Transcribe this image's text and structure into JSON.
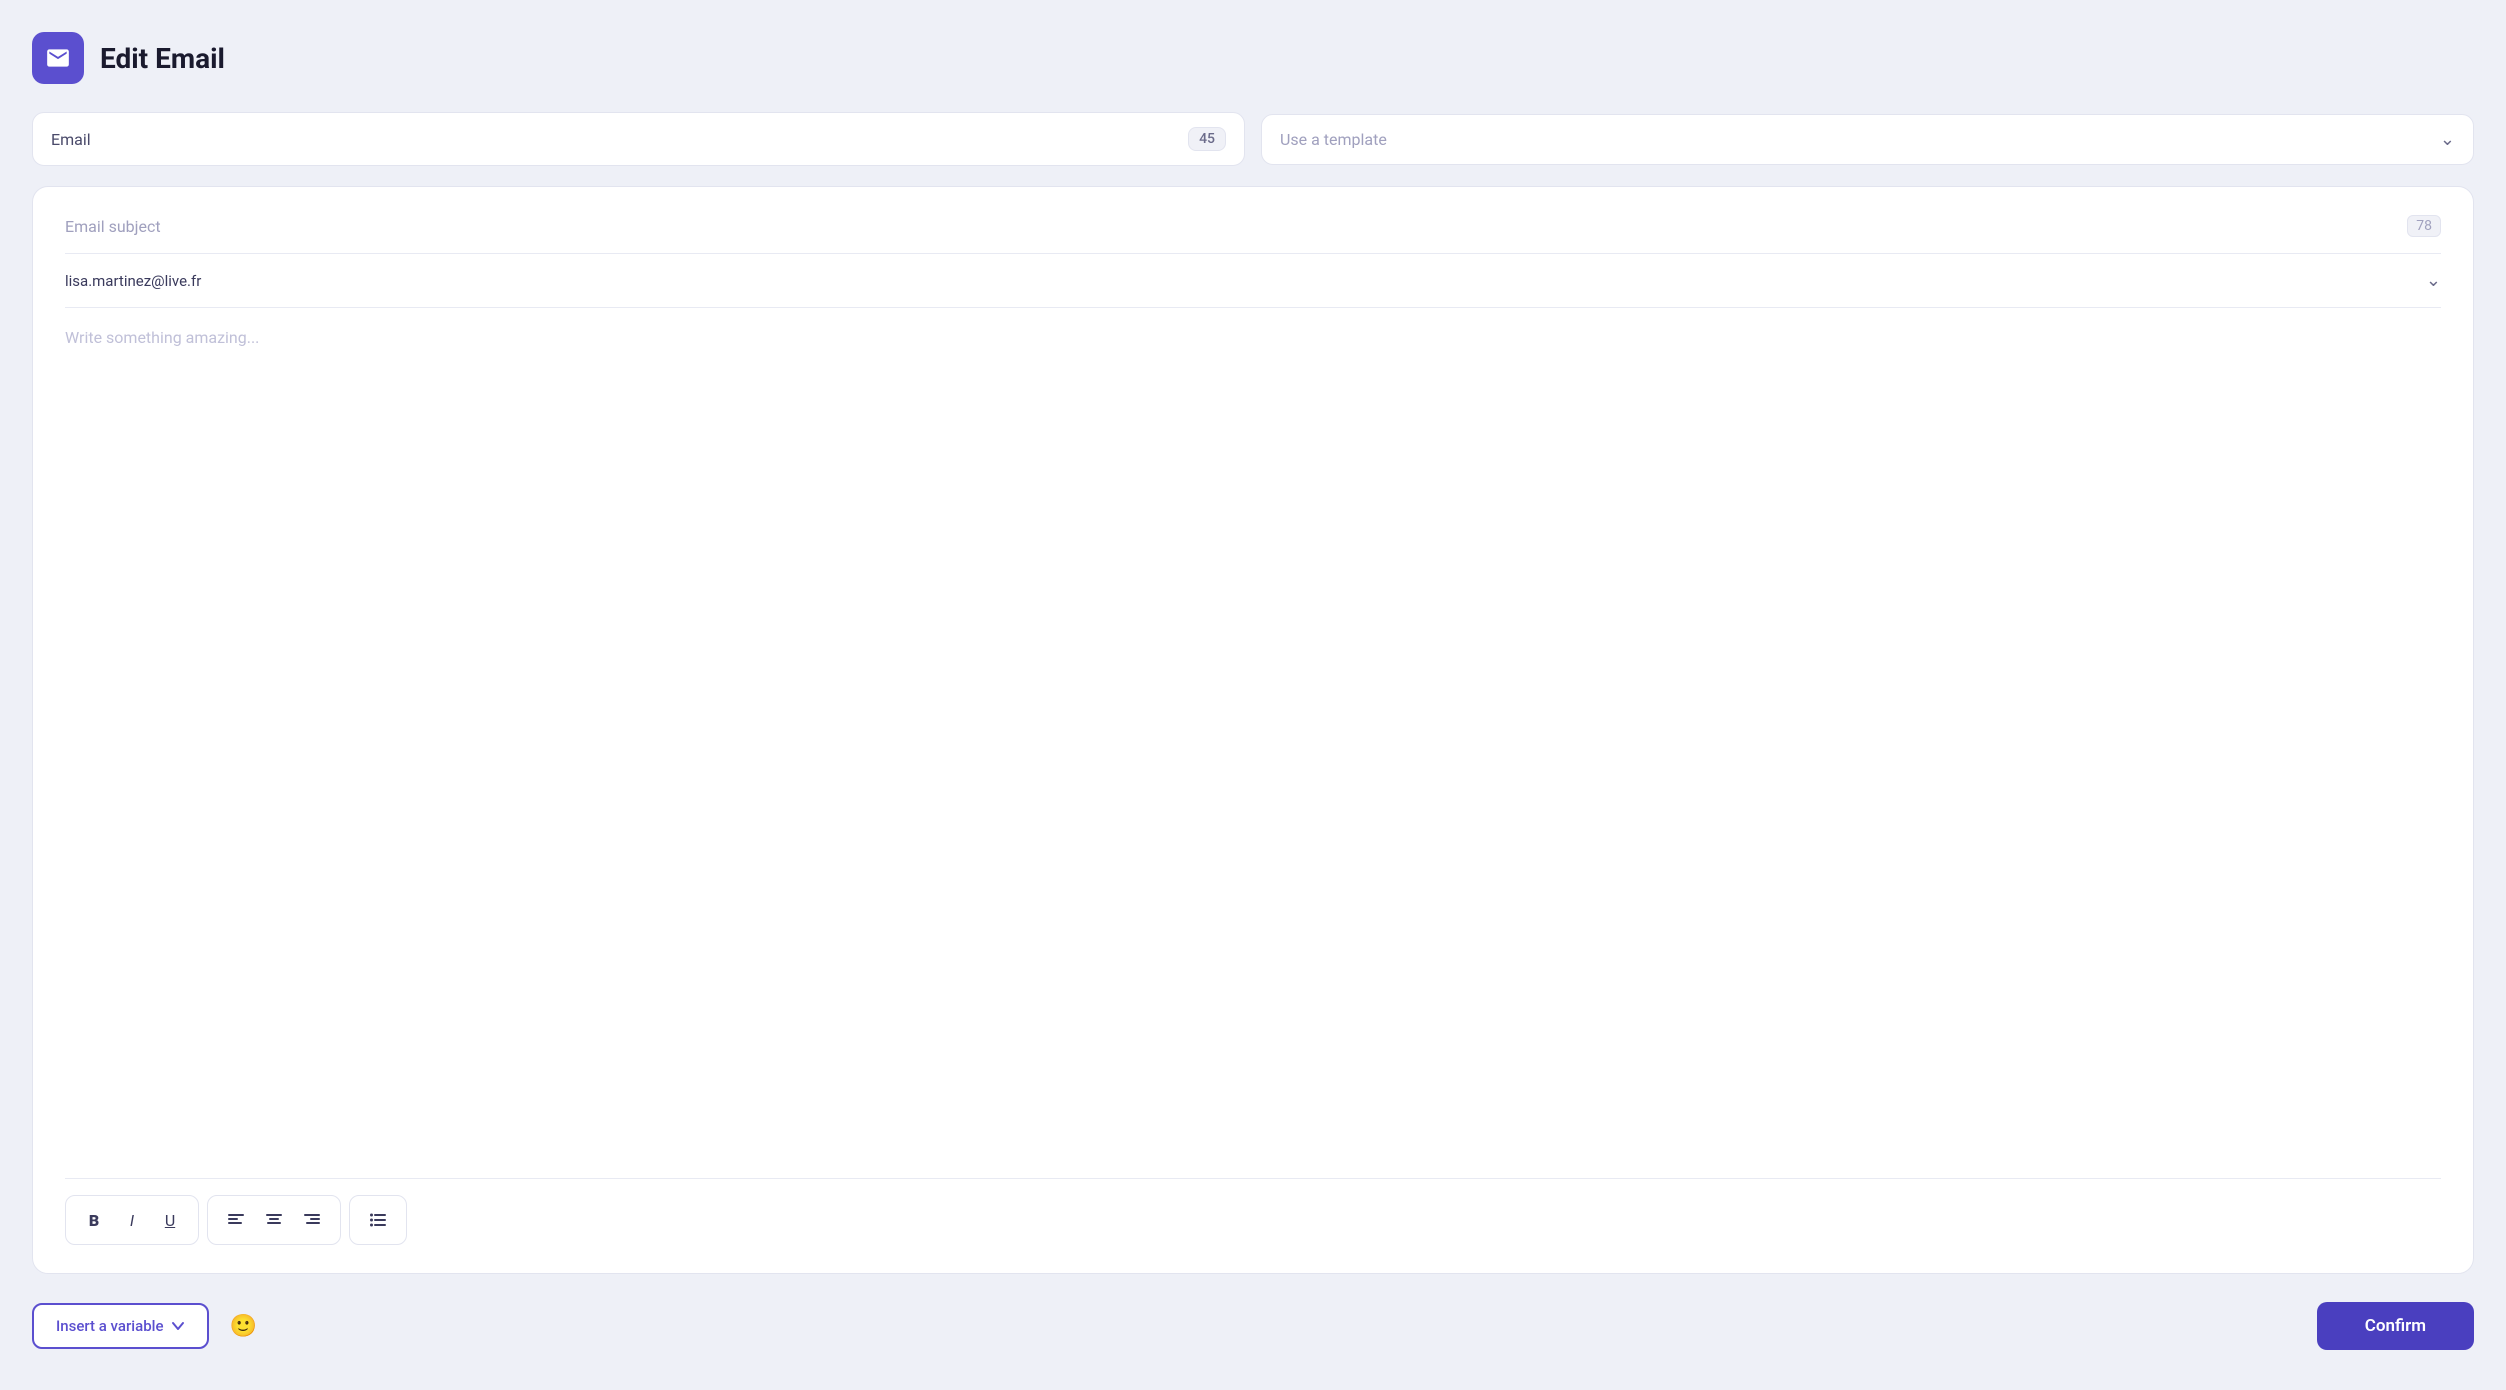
{
  "header": {
    "title": "Edit Email",
    "icon_label": "email-icon"
  },
  "top_row": {
    "email_label": "Email",
    "email_badge": "45",
    "template_placeholder": "Use a template"
  },
  "editor": {
    "subject_placeholder": "Email subject",
    "subject_count": "78",
    "recipient_email": "lisa.martinez@live.fr",
    "body_placeholder": "Write something amazing...",
    "toolbar": {
      "bold_label": "B",
      "italic_label": "I",
      "underline_label": "U",
      "align_left_label": "align-left",
      "align_center_label": "align-center",
      "align_right_label": "align-right",
      "list_label": "list"
    }
  },
  "bottom_bar": {
    "insert_variable_label": "Insert a variable",
    "confirm_label": "Confirm"
  }
}
